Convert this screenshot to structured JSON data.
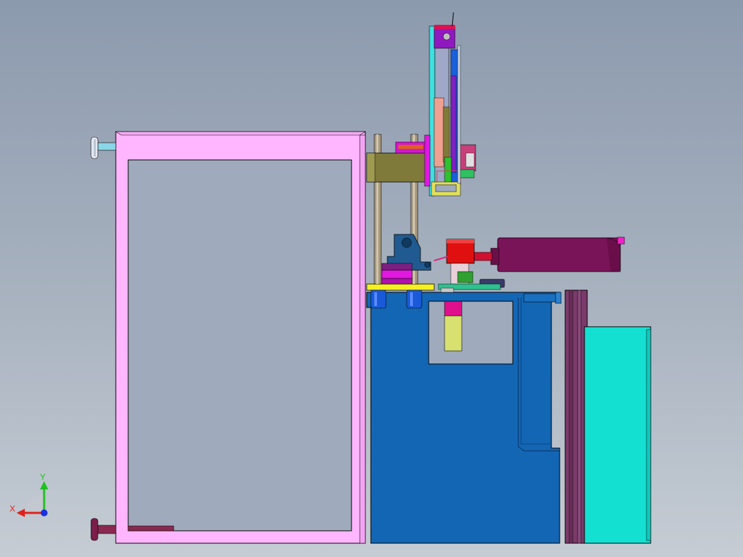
{
  "viewport": {
    "background_top": "#8c9aae",
    "background_bottom": "#c5ccd4"
  },
  "triad": {
    "x_label": "X",
    "y_label": "Y",
    "x_color": "#e0201a",
    "y_color": "#20c020",
    "z_color": "#1a30e0"
  },
  "model": {
    "colors": {
      "frame": "#ffb6ff",
      "base_block": "#1366b4",
      "cover_dark": "#7a3a6a",
      "cyan_box": "#14e0d2",
      "motor": "#7a1458",
      "red_block": "#e01010",
      "olive": "#807a3a",
      "yellow_plate": "#f5f020"
    }
  }
}
